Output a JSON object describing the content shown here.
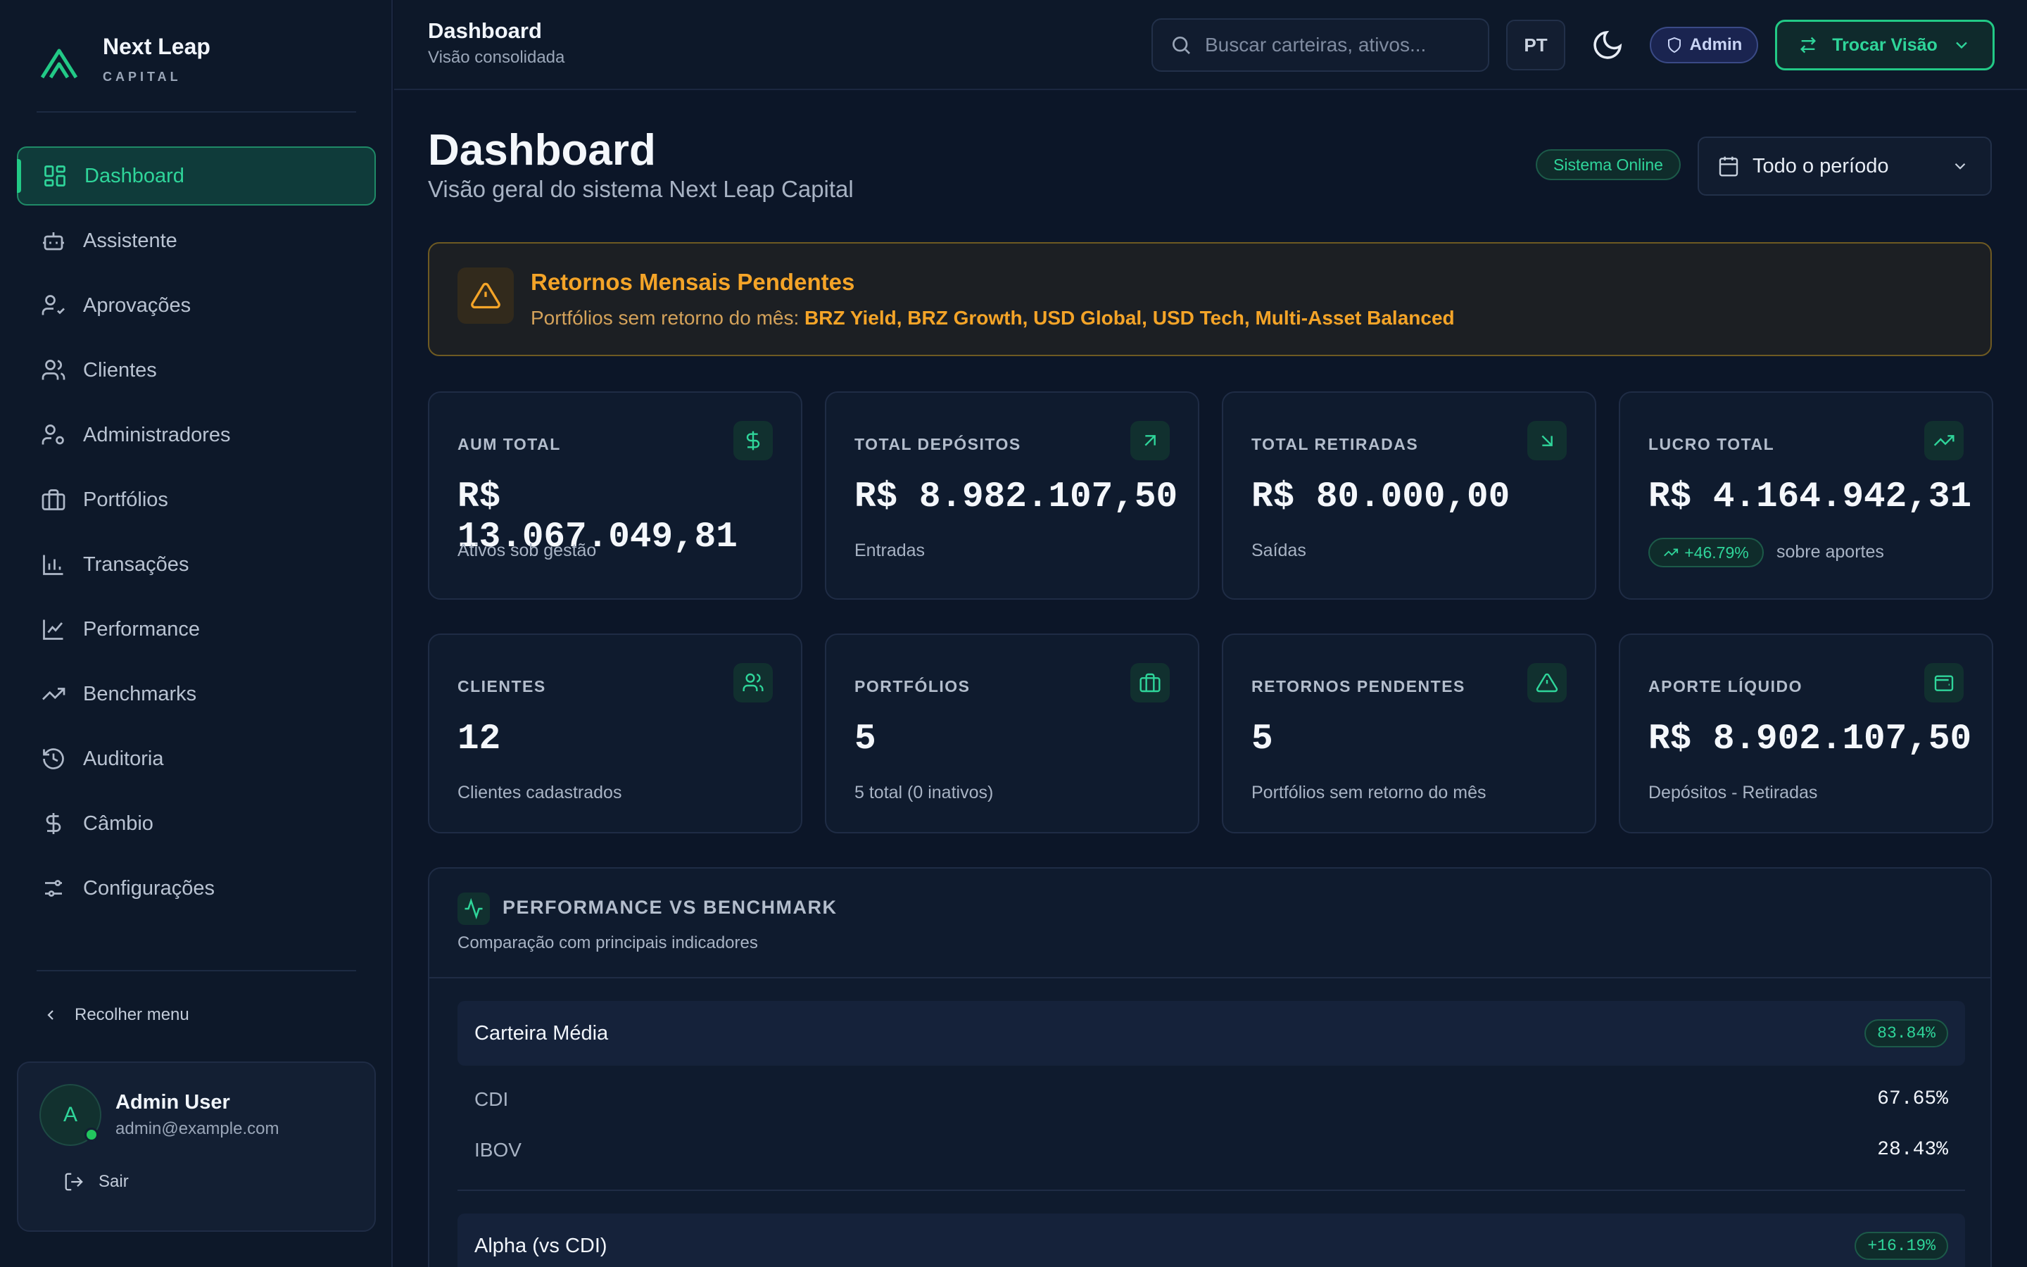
{
  "brand": {
    "name": "Next Leap",
    "sub": "CAPITAL"
  },
  "sidebar": {
    "items": [
      {
        "label": "Dashboard",
        "icon": "dashboard-icon",
        "active": true
      },
      {
        "label": "Assistente",
        "icon": "bot-icon"
      },
      {
        "label": "Aprovações",
        "icon": "user-check-icon"
      },
      {
        "label": "Clientes",
        "icon": "users-icon"
      },
      {
        "label": "Administradores",
        "icon": "user-cog-icon"
      },
      {
        "label": "Portfólios",
        "icon": "briefcase-icon"
      },
      {
        "label": "Transações",
        "icon": "bar-chart-icon"
      },
      {
        "label": "Performance",
        "icon": "line-chart-icon"
      },
      {
        "label": "Benchmarks",
        "icon": "trending-up-icon"
      },
      {
        "label": "Auditoria",
        "icon": "history-icon"
      },
      {
        "label": "Câmbio",
        "icon": "dollar-icon"
      },
      {
        "label": "Configurações",
        "icon": "sliders-icon"
      }
    ],
    "collapse_label": "Recolher menu",
    "user": {
      "initial": "A",
      "name": "Admin User",
      "email": "admin@example.com",
      "logout_label": "Sair"
    }
  },
  "topbar": {
    "title": "Dashboard",
    "subtitle": "Visão consolidada",
    "search_placeholder": "Buscar carteiras, ativos...",
    "lang": "PT",
    "role_badge": "Admin",
    "switch_label": "Trocar Visão"
  },
  "header": {
    "title": "Dashboard",
    "subtitle": "Visão geral do sistema Next Leap Capital",
    "status": "Sistema Online",
    "period": "Todo o período"
  },
  "alert": {
    "title": "Retornos Mensais Pendentes",
    "prefix": "Portfólios sem retorno do mês: ",
    "items": "BRZ Yield, BRZ Growth, USD Global, USD Tech, Multi-Asset Balanced"
  },
  "stats_row1": [
    {
      "label": "AUM TOTAL",
      "value": "R$ 13.067.049,81",
      "note": "Ativos sob gestão",
      "icon": "dollar-icon"
    },
    {
      "label": "TOTAL DEPÓSITOS",
      "value": "R$ 8.982.107,50",
      "note": "Entradas",
      "icon": "arrow-up-right-icon"
    },
    {
      "label": "TOTAL RETIRADAS",
      "value": "R$ 80.000,00",
      "note": "Saídas",
      "icon": "arrow-down-right-icon"
    },
    {
      "label": "LUCRO TOTAL",
      "value": "R$ 4.164.942,31",
      "growth": "+46.79%",
      "note": "sobre aportes",
      "icon": "trending-up-icon"
    }
  ],
  "stats_row2": [
    {
      "label": "CLIENTES",
      "value": "12",
      "note": "Clientes cadastrados",
      "icon": "users-icon"
    },
    {
      "label": "PORTFÓLIOS",
      "value": "5",
      "note": "5 total (0 inativos)",
      "icon": "briefcase-icon"
    },
    {
      "label": "RETORNOS PENDENTES",
      "value": "5",
      "note": "Portfólios sem retorno do mês",
      "icon": "alert-triangle-icon"
    },
    {
      "label": "APORTE LÍQUIDO",
      "value": "R$ 8.902.107,50",
      "note": "Depósitos - Retiradas",
      "icon": "wallet-icon"
    }
  ],
  "performance": {
    "title": "PERFORMANCE VS BENCHMARK",
    "subtitle": "Comparação com principais indicadores",
    "main": {
      "label": "Carteira Média",
      "value": "83.84%"
    },
    "rows": [
      {
        "label": "CDI",
        "value": "67.65%"
      },
      {
        "label": "IBOV",
        "value": "28.43%"
      }
    ],
    "alpha": {
      "label": "Alpha (vs CDI)",
      "value": "+16.19%"
    }
  },
  "colors": {
    "accent": "#22c986",
    "warning": "#f4a428",
    "background": "#0c1628"
  }
}
